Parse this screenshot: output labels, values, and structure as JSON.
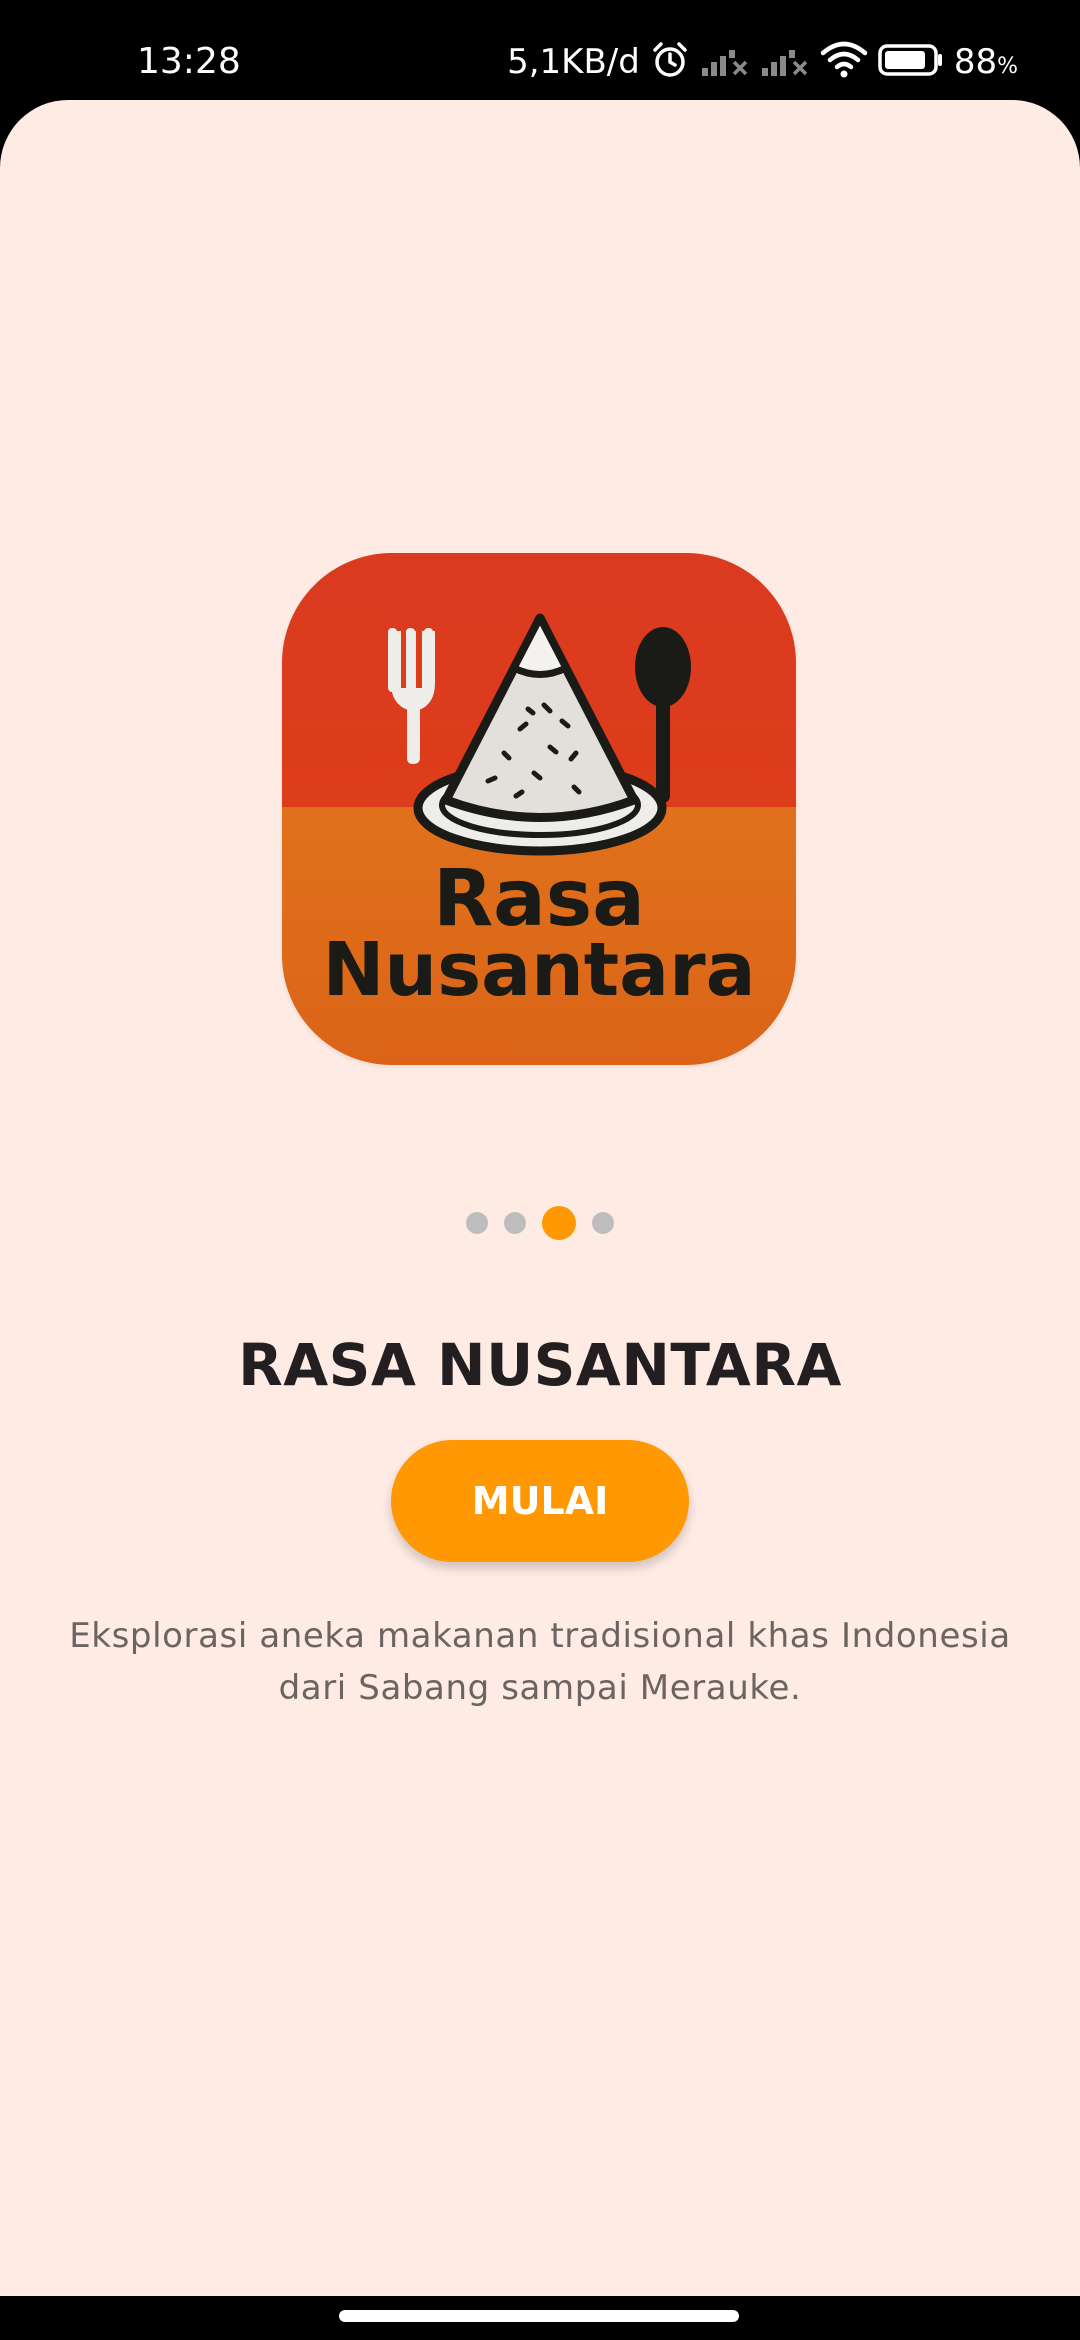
{
  "status_bar": {
    "time": "13:28",
    "network_speed": "5,1KB/d",
    "battery_percent": "88",
    "battery_percent_sign": "%",
    "battery_level": 0.88,
    "icons": [
      "alarm-icon",
      "signal-off-icon",
      "signal-off-icon",
      "wifi-icon",
      "battery-icon"
    ]
  },
  "logo": {
    "line1": "Rasa",
    "line2": "Nusantara",
    "colors": {
      "top": "#DE3D1C",
      "bottom": "#E0711B",
      "ink": "#1A1A16",
      "plate": "#EFEDEA"
    }
  },
  "pager": {
    "count": 4,
    "active_index": 2,
    "active_color": "#FF9803",
    "inactive_color": "#BDBDBD"
  },
  "title": "RASA NUSANTARA",
  "start_button": {
    "label": "MULAI",
    "color": "#FF9803"
  },
  "description": {
    "line1": "Eksplorasi aneka makanan tradisional khas Indonesia",
    "line2": "dari Sabang sampai Merauke."
  },
  "colors": {
    "background": "#FDEBE4",
    "title_text": "#231F20",
    "description_text": "#6B6461"
  }
}
